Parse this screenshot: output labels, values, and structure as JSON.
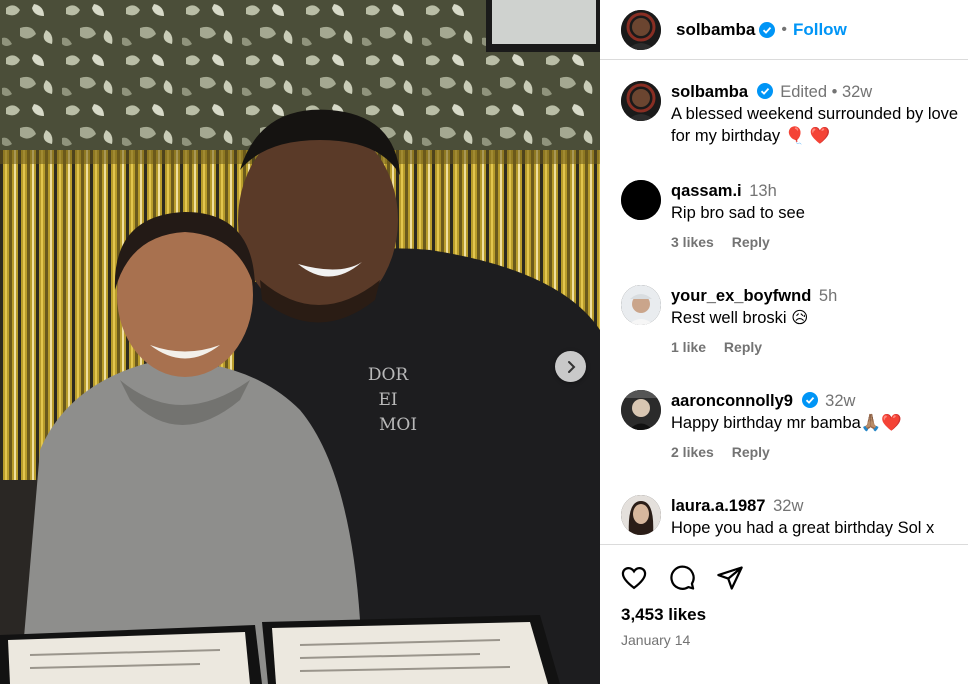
{
  "post": {
    "author": "solbamba",
    "follow_label": "Follow",
    "dot": "•",
    "caption_meta": "Edited • 32w",
    "caption_line1": "A blessed weekend surrounded by love",
    "caption_line2": "for my birthday 🎈 ❤️",
    "likes": "3,453 likes",
    "date": "January 14",
    "jersey_text": [
      "DOR",
      "EI",
      "MOI"
    ]
  },
  "comments": [
    {
      "user": "qassam.i",
      "time": "13h",
      "text": "Rip bro sad to see",
      "likes": "3 likes",
      "reply": "Reply",
      "verified": false
    },
    {
      "user": "your_ex_boyfwnd",
      "time": "5h",
      "text": "Rest well broski 😥",
      "likes": "1 like",
      "reply": "Reply",
      "verified": false
    },
    {
      "user": "aaronconnolly9",
      "time": "32w",
      "text": "Happy birthday mr bamba🙏🏽❤️",
      "likes": "2 likes",
      "reply": "Reply",
      "verified": true
    },
    {
      "user": "laura.a.1987",
      "time": "32w",
      "text": "Hope you had a great birthday Sol x",
      "likes": "",
      "reply": "",
      "verified": false
    }
  ],
  "icons": [
    "heart-icon",
    "comment-icon",
    "share-icon",
    "chevron-right-icon",
    "verified-badge-icon"
  ],
  "colors": {
    "accent": "#0095f6",
    "muted": "#737373",
    "border": "#dbdbdb",
    "verified": "#0095f6"
  }
}
